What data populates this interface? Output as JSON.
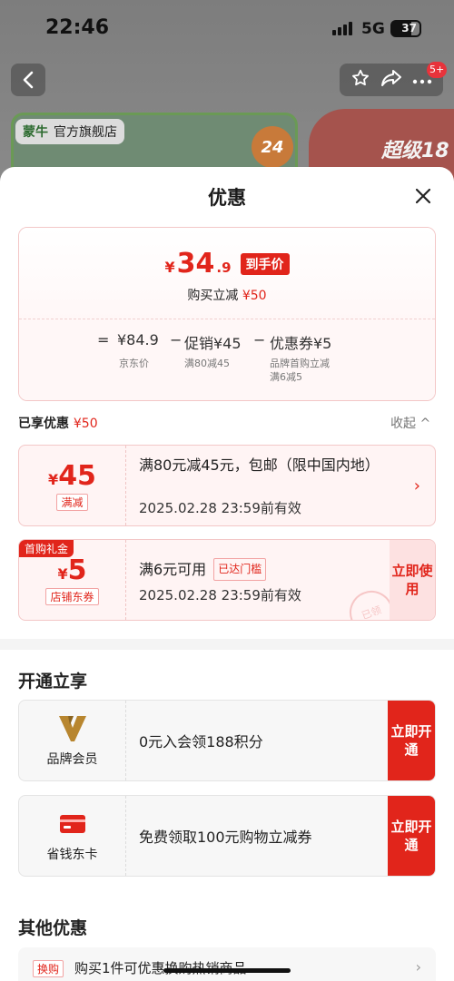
{
  "status_bar": {
    "time": "22:46",
    "network": "5G",
    "battery": "37"
  },
  "header": {
    "badge": "5+"
  },
  "product": {
    "store_name": "官方旗舰店",
    "brand": "蒙牛",
    "days_badge": "24",
    "promo_text": "超级18"
  },
  "sheet": {
    "title": "优惠",
    "price": {
      "currency": "¥",
      "integer": "34",
      "decimal": ".9",
      "tag": "到手价",
      "sub_label": "购买立减",
      "sub_amount": "¥50",
      "formula": {
        "eq": "=",
        "jd_price": "¥84.9",
        "jd_price_label": "京东价",
        "minus1": "−",
        "promo": "促销¥45",
        "promo_label": "满80减45",
        "minus2": "−",
        "coupon": "优惠券¥5",
        "coupon_label1": "品牌首购立减",
        "coupon_label2": "满6减5"
      }
    },
    "enjoyed": {
      "label": "已享优惠",
      "amount": "¥50",
      "collapse": "收起 ^"
    },
    "coupons": [
      {
        "currency": "¥",
        "amount": "45",
        "tag": "满减",
        "text": "满80元减45元，包邮（限中国内地）",
        "date": "2025.02.28 23:59前有效",
        "arrow": "›"
      },
      {
        "first_tag": "首购礼金",
        "currency": "¥",
        "amount": "5",
        "tag": "店铺东券",
        "text": "满6元可用",
        "reached": "已达门槛",
        "date": "2025.02.28 23:59前有效",
        "button": "立即使用",
        "stamp": "已领"
      }
    ],
    "open_section": {
      "title": "开通立享",
      "items": [
        {
          "label": "品牌会员",
          "text": "0元入会领188积分",
          "button": "立即开通",
          "icon": "brand-member-icon"
        },
        {
          "label": "省钱东卡",
          "text": "免费领取100元购物立减券",
          "button": "立即开通",
          "icon": "card-icon"
        }
      ]
    },
    "other_section": {
      "title": "其他优惠",
      "items": [
        {
          "tag": "换购",
          "text": "购买1件可优惠换购热销商品",
          "arrow": "›"
        }
      ]
    }
  },
  "colors": {
    "accent": "#e1251b",
    "brand_gold": "#b8862f"
  }
}
